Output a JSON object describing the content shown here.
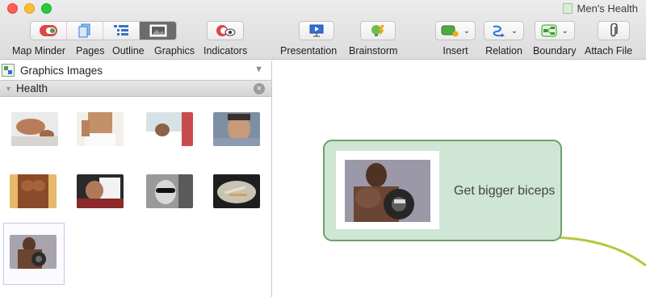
{
  "window": {
    "title": "Men's Health"
  },
  "toolbar": {
    "view_modes": [
      {
        "label": "Map Minder",
        "icon": "map-minder-icon"
      },
      {
        "label": "Pages",
        "icon": "pages-icon"
      },
      {
        "label": "Outline",
        "icon": "outline-icon"
      },
      {
        "label": "Graphics",
        "icon": "graphics-icon",
        "active": true
      }
    ],
    "indicators_label": "Indicators",
    "presentation_label": "Presentation",
    "brainstorm_label": "Brainstorm",
    "insert_label": "Insert",
    "relation_label": "Relation",
    "boundary_label": "Boundary",
    "attach_file_label": "Attach File"
  },
  "panel": {
    "source_label": "Graphics Images",
    "category_label": "Health",
    "thumbnails": [
      "man-lying-down-photo",
      "towel-torso-photo",
      "hospital-patient-photo",
      "smiling-man-photo",
      "muscular-chest-photo",
      "man-on-pillow-photo",
      "sunglasses-man-photo",
      "cigarette-ashtray-photo",
      "dumbbell-curl-photo"
    ]
  },
  "canvas": {
    "topic_text": "Get bigger biceps",
    "topic_image": "dumbbell-curl-photo"
  },
  "colors": {
    "topic_fill": "#cfe5d5",
    "topic_border": "#6aa36a",
    "connector": "#b8c63a",
    "graphics_active": "#6b6b6b"
  }
}
